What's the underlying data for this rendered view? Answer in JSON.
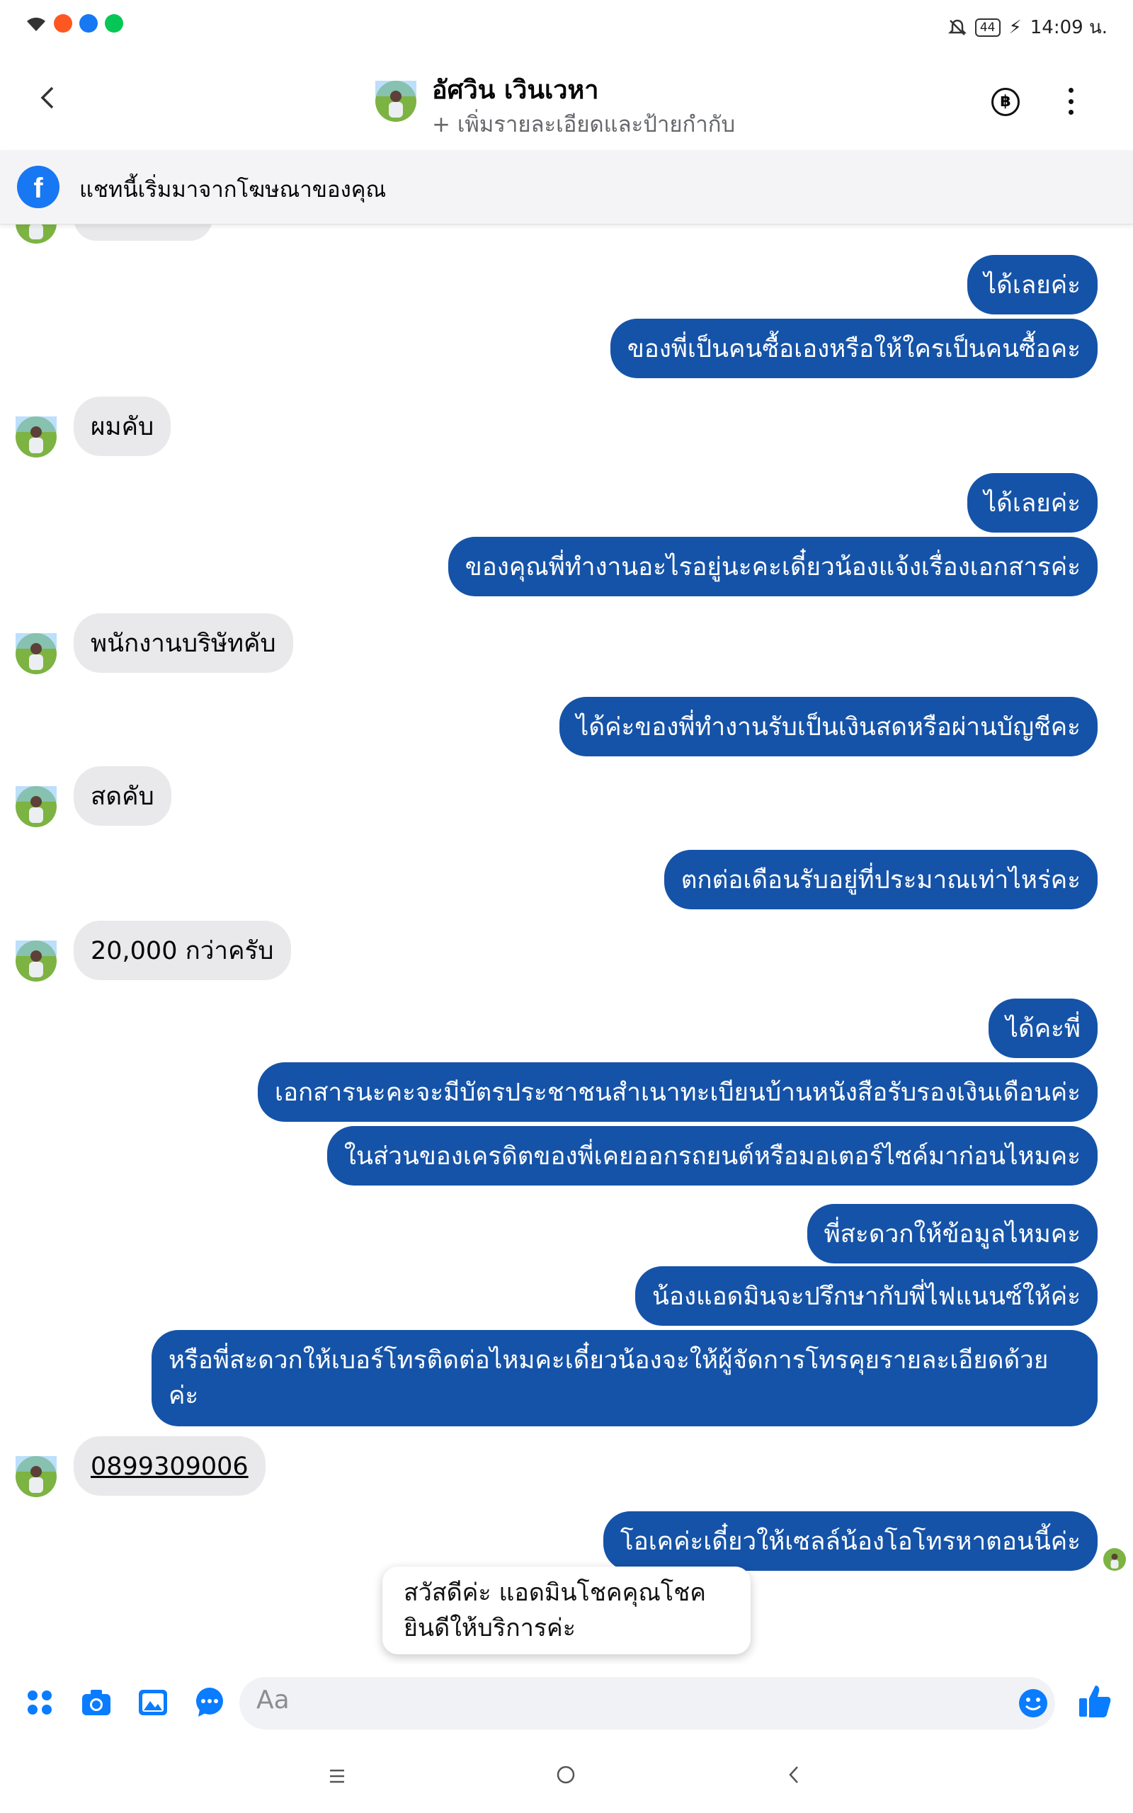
{
  "status_bar": {
    "time": "14:09 น.",
    "battery": "44"
  },
  "header": {
    "contact_name": "อัศวิน เวินเวหา",
    "subtitle": "+ เพิ่มรายละเอียดและป้ายกำกับ",
    "baht_symbol": "฿"
  },
  "banner": {
    "icon": "f",
    "text": "แชทนี้เริ่มมาจากโฆษณาของคุณ"
  },
  "messages": [
    {
      "from": "me",
      "text": "ได้เลยค่ะ"
    },
    {
      "from": "me",
      "text": "ของพี่เป็นคนซื้อเองหรือให้ใครเป็นคนซื้อคะ"
    },
    {
      "from": "them",
      "text": "ผมคับ"
    },
    {
      "from": "me",
      "text": "ได้เลยค่ะ"
    },
    {
      "from": "me",
      "text": "ของคุณพี่ทำงานอะไรอยู่นะคะเดี๋ยวน้องแจ้งเรื่องเอกสารค่ะ"
    },
    {
      "from": "them",
      "text": "พนักงานบริษัทคับ"
    },
    {
      "from": "me",
      "text": "ได้ค่ะของพี่ทำงานรับเป็นเงินสดหรือผ่านบัญชีคะ"
    },
    {
      "from": "them",
      "text": "สดคับ"
    },
    {
      "from": "me",
      "text": "ตกต่อเดือนรับอยู่ที่ประมาณเท่าไหร่คะ"
    },
    {
      "from": "them",
      "text": "20,000 กว่าครับ"
    },
    {
      "from": "me",
      "text": "ได้คะพี่"
    },
    {
      "from": "me",
      "text": "เอกสารนะคะจะมีบัตรประชาชนสำเนาทะเบียนบ้านหนังสือรับรองเงินเดือนค่ะ"
    },
    {
      "from": "me",
      "text": "ในส่วนของเครดิตของพี่เคยออกรถยนต์หรือมอเตอร์ไซค์มาก่อนไหมคะ"
    },
    {
      "from": "me",
      "text": "พี่สะดวกให้ข้อมูลไหมคะ"
    },
    {
      "from": "me",
      "text": "น้องแอดมินจะปรึกษากับพี่ไฟแนนซ์ให้ค่ะ"
    },
    {
      "from": "me",
      "text": "หรือพี่สะดวกให้เบอร์โทรติดต่อไหมคะเดี๋ยวน้องจะให้ผู้จัดการโทรคุยรายละเอียดด้วย",
      "text2": "ค่ะ"
    },
    {
      "from": "them",
      "text": "0899309006"
    },
    {
      "from": "me",
      "text": "โอเคค่ะเดี๋ยวให้เซลล์น้องโอโทรหาตอนนี้ค่ะ"
    }
  ],
  "toast": {
    "line1": "สวัสดีค่ะ แอดมินโชคคุณโชค",
    "line2": "ยินดีให้บริการค่ะ"
  },
  "composer": {
    "placeholder": "Aa"
  },
  "colors": {
    "outgoing_bubble": "#1553a8",
    "incoming_bubble": "#e9e9eb",
    "messenger_blue": "#0a7cff"
  }
}
